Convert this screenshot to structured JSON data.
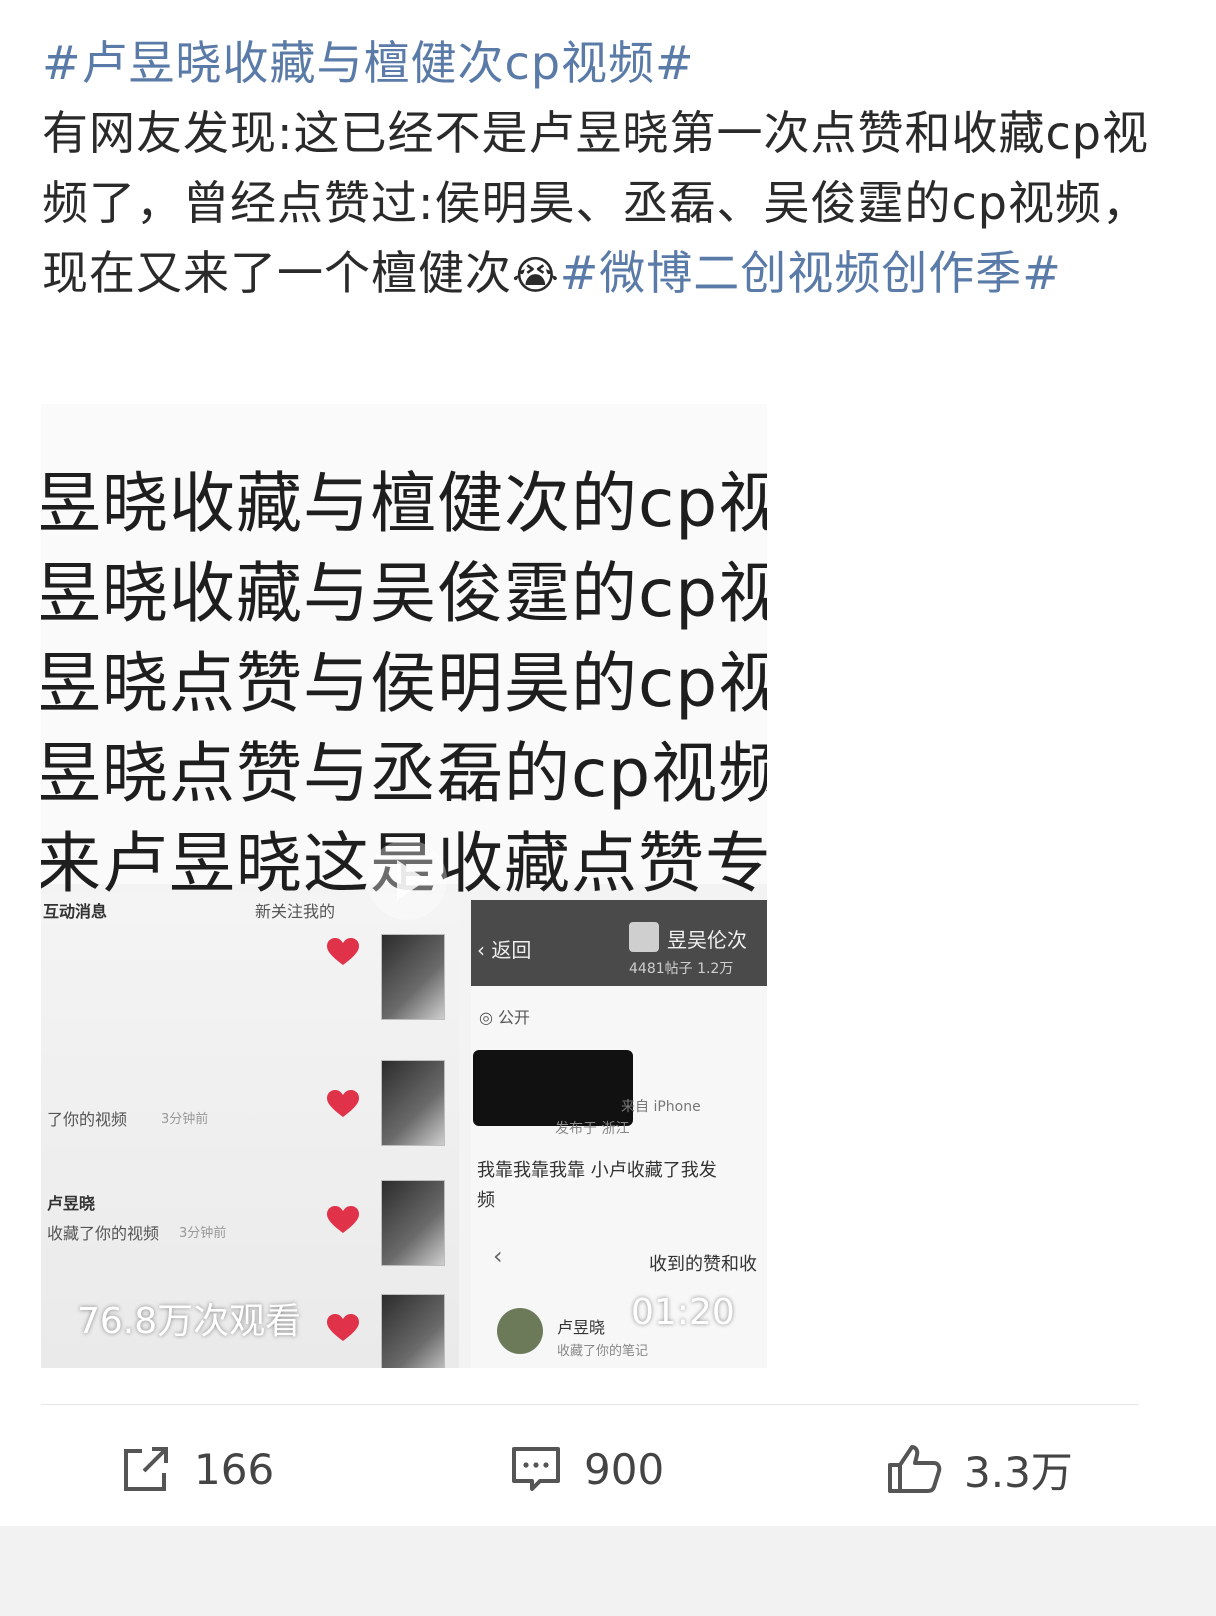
{
  "post": {
    "topic": "#卢昱晓收藏与檀健次cp视频#",
    "body": "有网友发现:这已经不是卢昱晓第一次点赞和收藏cp视频了，曾经点赞过:侯明昊、丞磊、吴俊霆的cp视频，现在又来了一个檀健次",
    "emoji": "😭",
    "tag2": "#微博二创视频创作季#"
  },
  "video": {
    "caption_lines": [
      "昱晓收藏与檀健次的cp视",
      "昱晓收藏与吴俊霆的cp视",
      "昱晓点赞与侯明昊的cp视",
      "昱晓点赞与丞磊的cp视频",
      "来卢昱晓这是收藏点赞专"
    ],
    "views": "76.8万次观看",
    "duration": "01:20",
    "left_shot": {
      "header_left": "互动消息",
      "header_right": "新关注我的",
      "row1": "了你的视频",
      "row1_time": "3分钟前",
      "row2_name": "卢昱晓",
      "row2_text": "收藏了你的视频",
      "row2_time": "3分钟前"
    },
    "right_shot": {
      "back": "返回",
      "account": "昱吴伦次",
      "stats": "4481帖子 1.2万",
      "visibility": "公开",
      "meta": "发布于 浙江",
      "device": "来自 iPhone",
      "quote": "我靠我靠我靠 小卢收藏了我发",
      "quote2": "频",
      "nav_title": "收到的赞和收",
      "user": "卢昱晓",
      "user_text": "收藏了你的笔记"
    }
  },
  "actions": {
    "share_count": "166",
    "comment_count": "900",
    "like_count": "3.3万"
  },
  "colors": {
    "hashtag": "#5a7ba8",
    "text": "#2a2a2a",
    "icon": "#555555",
    "heart": "#e0334a"
  }
}
